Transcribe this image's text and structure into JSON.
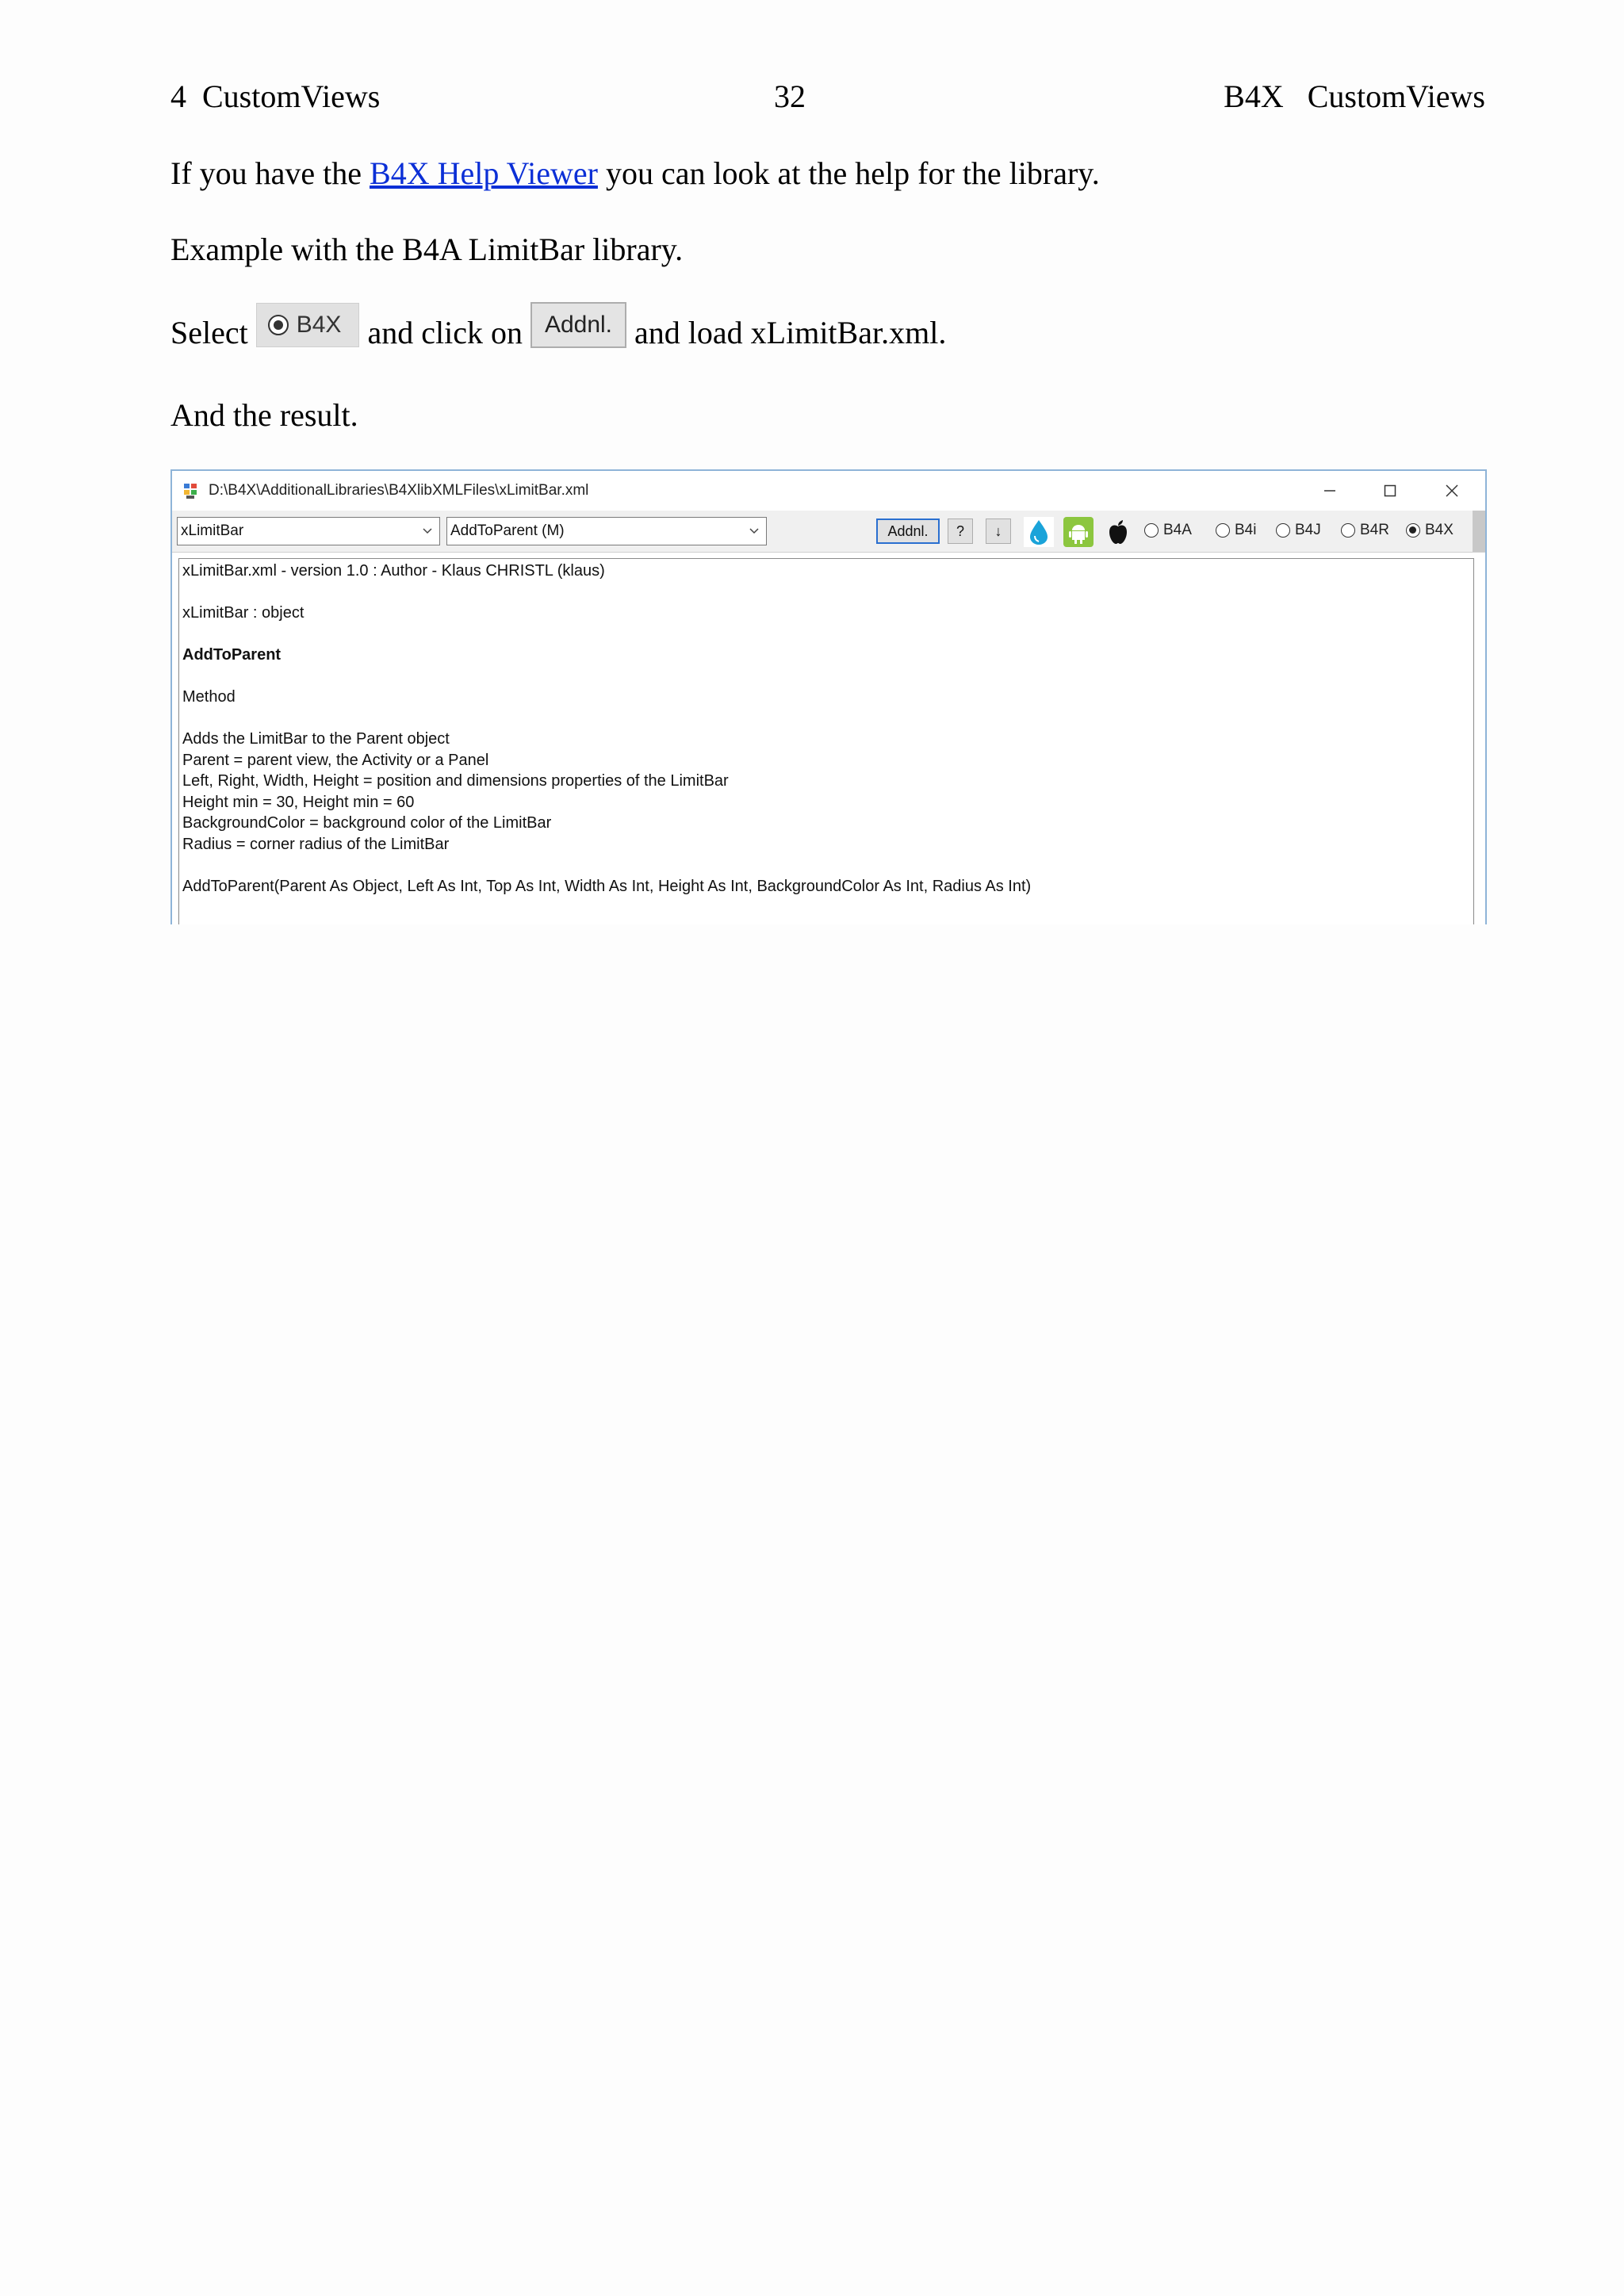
{
  "header": {
    "left": "4  CustomViews",
    "center": "32",
    "right": "B4X   CustomViews"
  },
  "paragraphs": {
    "p1_before": "If you have the ",
    "p1_link": "B4X Help Viewer",
    "p1_after": " you can look at the help for the library.",
    "p2": "Example with the B4A LimitBar library.",
    "p3_select": "Select",
    "p3_b4x_label": "B4X",
    "p3_click": "and click on",
    "p3_addnl_label": "Addnl.",
    "p3_load": "and load xLimitBar.xml.",
    "p4": "And the result."
  },
  "window": {
    "title": "D:\\B4X\\AdditionalLibraries\\B4XlibXMLFiles\\xLimitBar.xml",
    "combo_object": "xLimitBar",
    "combo_member": "AddToParent (M)",
    "btn_addnl": "Addnl.",
    "btn_help": "?",
    "btn_down": "↓",
    "icons": [
      "b4j-icon",
      "b4a-android-icon",
      "b4i-apple-icon"
    ],
    "platforms": [
      {
        "label": "B4A",
        "selected": false
      },
      {
        "label": "B4i",
        "selected": false
      },
      {
        "label": "B4J",
        "selected": false
      },
      {
        "label": "B4R",
        "selected": false
      },
      {
        "label": "B4X",
        "selected": true
      }
    ],
    "content": {
      "line1": "xLimitBar.xml - version 1.0 : Author - Klaus CHRISTL (klaus)",
      "line2": "xLimitBar :  object",
      "line3": "AddToParent",
      "line4": "Method",
      "line5": "Adds the LimitBar to the Parent object",
      "line6": "Parent = parent view, the Activity or a Panel",
      "line7": "Left, Right, Width, Height = position and dimensions properties of the LimitBar",
      "line8": "Height min = 30, Height min = 60",
      "line9": "BackgroundColor = background color of the LimitBar",
      "line10": "Radius = corner radius of the LimitBar",
      "line11": "AddToParent(Parent As Object, Left As Int, Top As Int, Width As Int, Height As Int, BackgroundColor As Int, Radius As Int)"
    }
  },
  "colors": {
    "link": "#0b2fd6",
    "window_border": "#8fb4d8",
    "addnl_focus": "#2a6fd0"
  }
}
